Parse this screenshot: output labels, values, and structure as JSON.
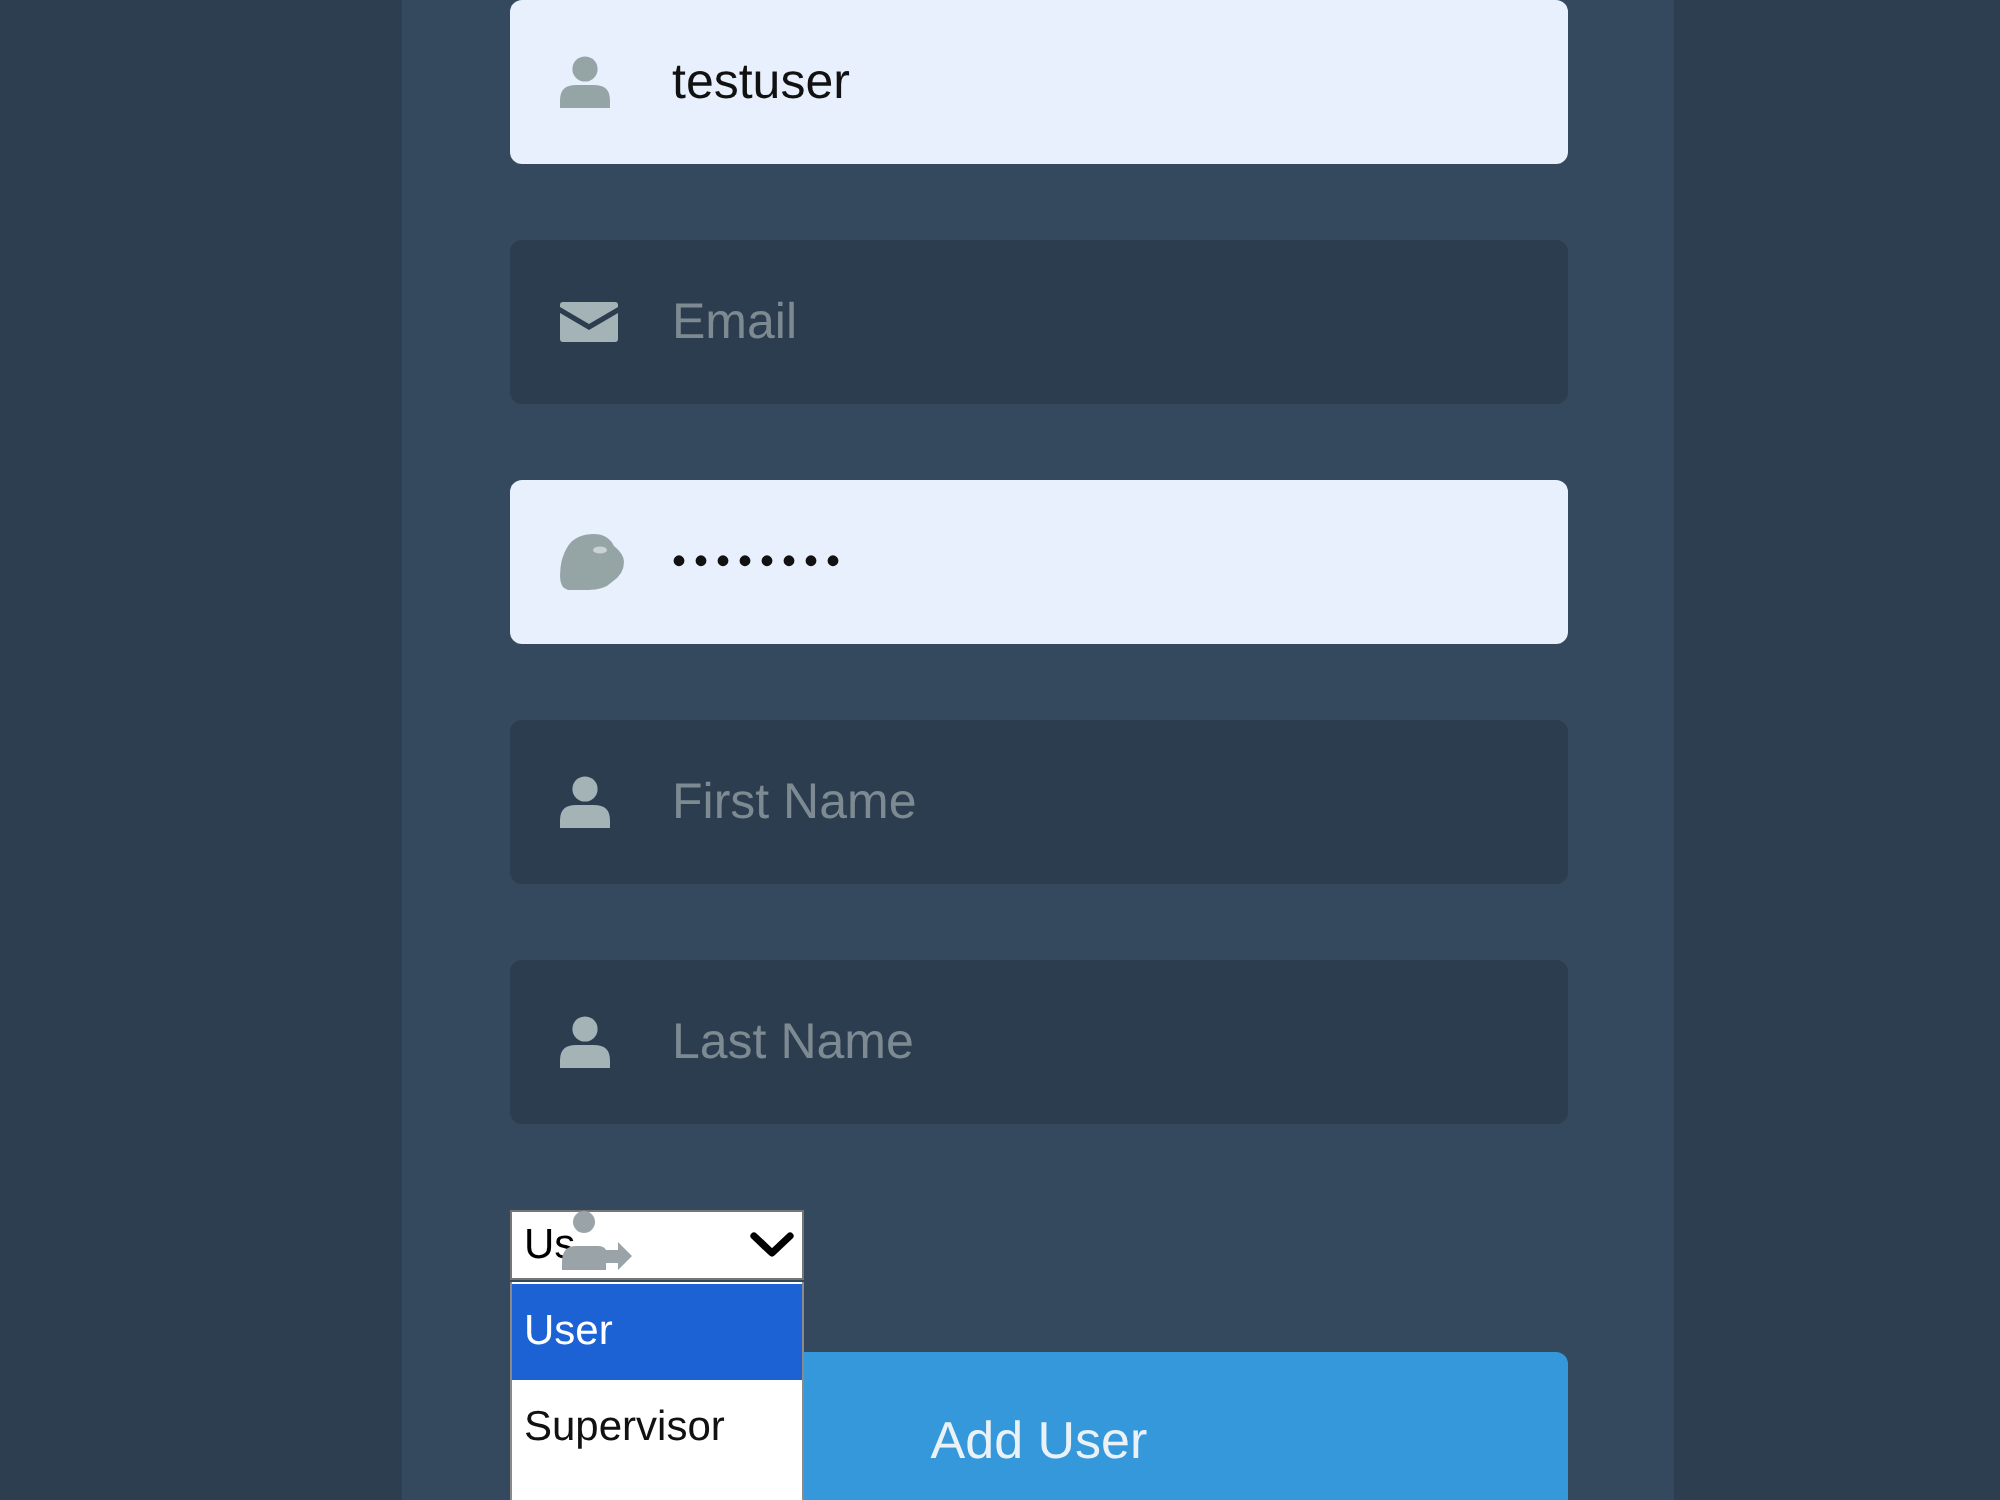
{
  "form": {
    "fields": [
      {
        "kind": "user",
        "value": "testuser"
      },
      {
        "kind": "email",
        "placeholder": "Email"
      },
      {
        "kind": "password",
        "value": "••••••••"
      },
      {
        "kind": "user",
        "placeholder": "First Name"
      },
      {
        "kind": "user",
        "placeholder": "Last Name"
      }
    ],
    "role_select": {
      "value": "Us",
      "options": [
        {
          "label": "User",
          "selected": true
        },
        {
          "label": "Supervisor",
          "selected": false
        }
      ]
    },
    "submit_button": "Add User"
  }
}
